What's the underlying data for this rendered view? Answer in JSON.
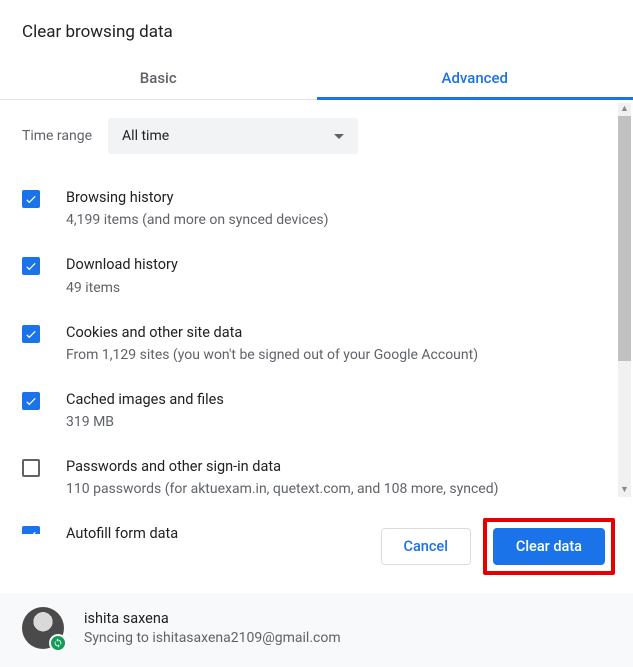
{
  "title": "Clear browsing data",
  "tabs": {
    "basic": "Basic",
    "advanced": "Advanced"
  },
  "time": {
    "label": "Time range",
    "value": "All time"
  },
  "options": [
    {
      "checked": true,
      "title": "Browsing history",
      "sub": "4,199 items (and more on synced devices)"
    },
    {
      "checked": true,
      "title": "Download history",
      "sub": "49 items"
    },
    {
      "checked": true,
      "title": "Cookies and other site data",
      "sub": "From 1,129 sites (you won't be signed out of your Google Account)"
    },
    {
      "checked": true,
      "title": "Cached images and files",
      "sub": "319 MB"
    },
    {
      "checked": false,
      "title": "Passwords and other sign-in data",
      "sub": "110 passwords (for aktuexam.in, quetext.com, and 108 more, synced)"
    },
    {
      "checked": true,
      "title": "Autofill form data",
      "sub": ""
    }
  ],
  "actions": {
    "cancel": "Cancel",
    "clear": "Clear data"
  },
  "user": {
    "name": "ishita saxena",
    "status": "Syncing to ishitasaxena2109@gmail.com"
  }
}
